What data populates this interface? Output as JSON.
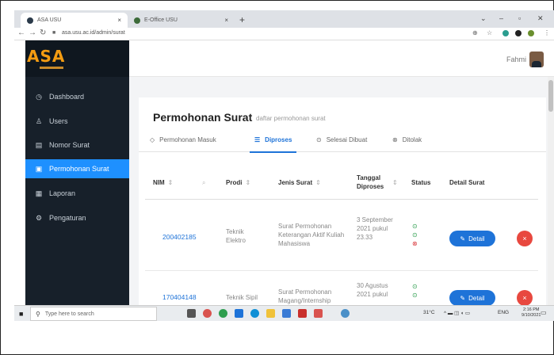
{
  "browser": {
    "tabs": [
      {
        "title": "ASA USU",
        "active": true
      },
      {
        "title": "E-Office USU",
        "active": false
      }
    ],
    "url": "asa.usu.ac.id/admin/surat"
  },
  "app": {
    "logo_text": "ASA",
    "user_name": "Fahmi",
    "sidebar": [
      {
        "label": "Dashboard",
        "icon": "dashboard-icon",
        "glyph": "◷",
        "active": false
      },
      {
        "label": "Users",
        "icon": "user-icon",
        "glyph": "♙",
        "active": false
      },
      {
        "label": "Nomor Surat",
        "icon": "list-icon",
        "glyph": "▤",
        "active": false
      },
      {
        "label": "Permohonan Surat",
        "icon": "document-icon",
        "glyph": "▣",
        "active": true
      },
      {
        "label": "Laporan",
        "icon": "report-icon",
        "glyph": "▦",
        "active": false
      },
      {
        "label": "Pengaturan",
        "icon": "gear-icon",
        "glyph": "⚙",
        "active": false
      }
    ],
    "page_title": "Permohonan Surat",
    "page_subtitle": "daftar permohonan surat",
    "content_tabs": [
      {
        "label": "Permohonan Masuk",
        "icon": "inbox-icon",
        "glyph": "◇",
        "active": false
      },
      {
        "label": "Diproses",
        "icon": "process-icon",
        "glyph": "☰",
        "active": true
      },
      {
        "label": "Selesai Dibuat",
        "icon": "check-circle-icon",
        "glyph": "⊙",
        "active": false
      },
      {
        "label": "Ditolak",
        "icon": "reject-icon",
        "glyph": "⊗",
        "active": false
      }
    ],
    "table": {
      "columns": [
        "NIM",
        "Prodi",
        "Jenis Surat",
        "Tanggal Diproses",
        "Status",
        "Detail Surat"
      ],
      "rows": [
        {
          "nim": "200402185",
          "prodi": "Teknik Elektro",
          "jenis_surat": "Surat Permohonan Keterangan Aktif Kuliah Mahasiswa",
          "tanggal": "3 September 2021 pukul 23.33",
          "status": [
            "ok",
            "ok",
            "bad"
          ],
          "detail_label": "Detail"
        },
        {
          "nim": "170404148",
          "prodi": "Teknik Sipil",
          "jenis_surat": "Surat Permohonan Magang/Internship",
          "tanggal": "30 Agustus 2021 pukul",
          "status": [
            "ok",
            "ok"
          ],
          "detail_label": "Detail"
        }
      ]
    }
  },
  "taskbar": {
    "search_placeholder": "Type here to search",
    "weather": "31°C",
    "lang": "ENG",
    "time": "2:16 PM",
    "date": "9/10/2021"
  },
  "colors": {
    "sidebar_bg": "#17202a",
    "accent": "#1e90ff",
    "logo": "#f39c12",
    "danger": "#e8483f",
    "success": "#2e9e4f"
  }
}
